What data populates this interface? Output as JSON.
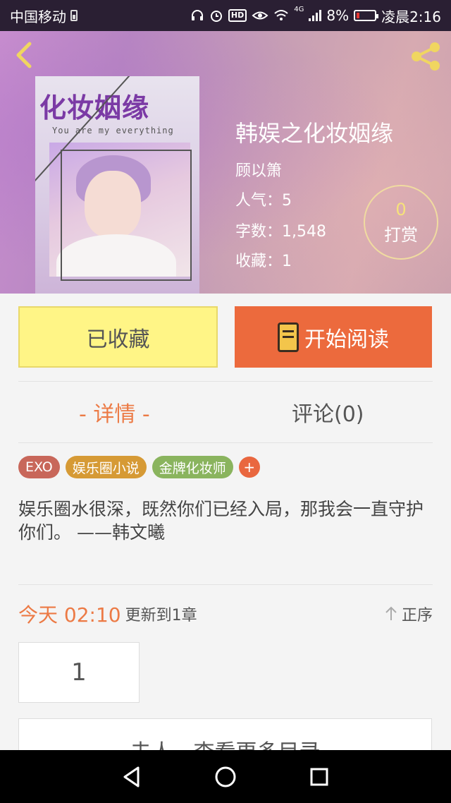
{
  "status_bar": {
    "carrier": "中国移动",
    "network": "4G",
    "battery": "8%",
    "time": "凌晨2:16"
  },
  "book": {
    "title": "韩娱之化妆姻缘",
    "author": "顾以箫",
    "popularity": "人气：5",
    "word_count": "字数：1,548",
    "favorites": "收藏：1",
    "cover_title": "化妆姻缘",
    "cover_subtitle": "You are my everything"
  },
  "reward": {
    "count": "0",
    "label": "打赏"
  },
  "actions": {
    "favorited_label": "已收藏",
    "read_label": "开始阅读"
  },
  "tabs": {
    "details": "- 详情 -",
    "comments": "评论(0)"
  },
  "tags": [
    {
      "label": "EXO",
      "color": "#c8675a"
    },
    {
      "label": "娱乐圈小说",
      "color": "#d69a35"
    },
    {
      "label": "金牌化妆师",
      "color": "#8ab45e"
    }
  ],
  "tag_add": "+",
  "description": "娱乐圈水很深，既然你们已经入局，那我会一直守护你们。    ——韩文曦",
  "update": {
    "time": "今天 02:10",
    "text": "更新到1章",
    "order": "正序"
  },
  "chapters": [
    "1"
  ],
  "more_chapters": "去人，查看更多目录",
  "colors": {
    "accent": "#ec7a45",
    "read_button": "#ec6a3d",
    "fav_button": "#fff586"
  }
}
